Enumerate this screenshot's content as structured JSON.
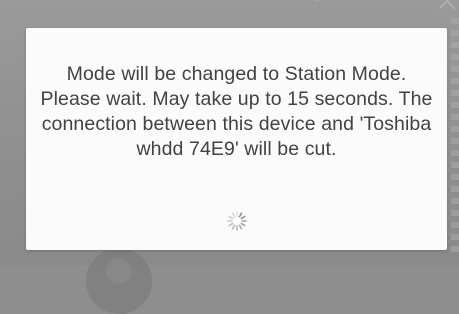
{
  "dialog": {
    "message": "Mode will be changed to Station Mode. Please wait. May take up to 15 seconds. The connection between this device and 'Toshiba whdd 74E9' will be cut.",
    "spinner_icon": "loading-spinner-icon"
  },
  "colors": {
    "backdrop": "#8e8e8e",
    "dialog_bg": "#fbfbfb",
    "text": "#424242",
    "spinner": "#8a8a8a"
  }
}
